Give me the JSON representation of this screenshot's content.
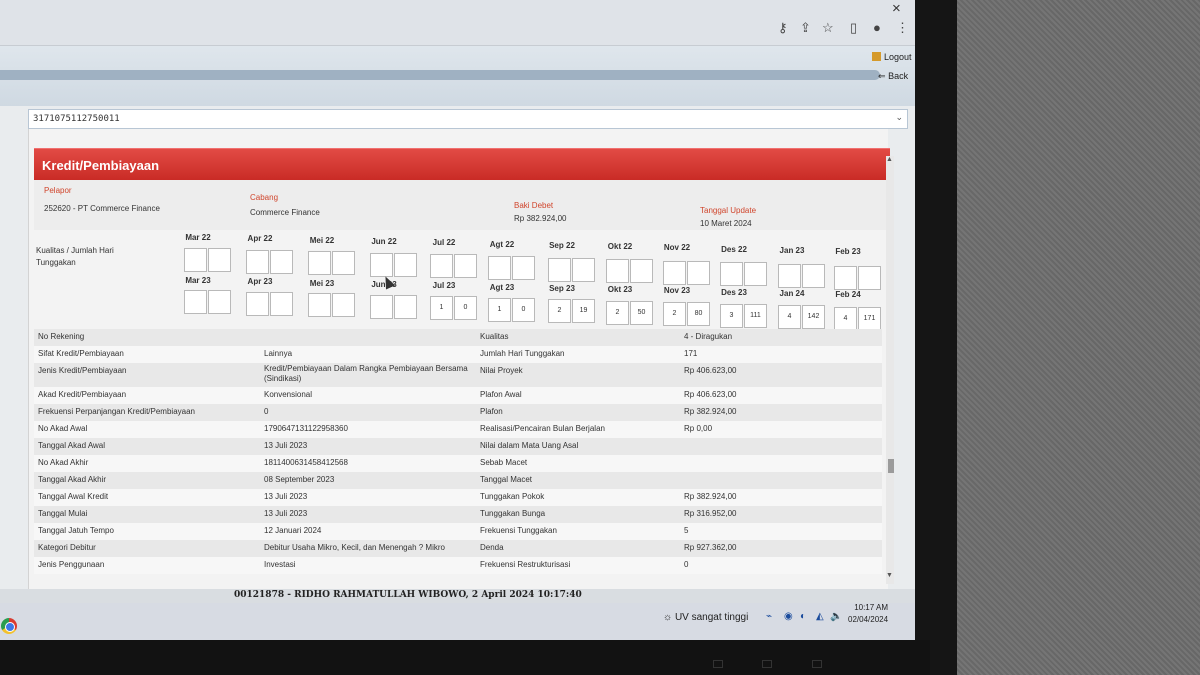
{
  "header": {
    "logout": "Logout",
    "back": "Back"
  },
  "nav": {
    "id": "317107511275001​1"
  },
  "section": {
    "title": "Kredit/Pembiayaan"
  },
  "info": {
    "pelapor_label": "Pelapor",
    "pelapor_value": "252620 - PT Commerce Finance",
    "cabang_label": "Cabang",
    "cabang_value": "Commerce Finance",
    "baki_label": "Baki Debet",
    "baki_value": "Rp 382.924,00",
    "tanggal_label": "Tanggal Update",
    "tanggal_value": "10 Maret 2024"
  },
  "kualitas_label": "Kualitas / Jumlah Hari Tunggakan",
  "months_row1": [
    "Mar 22",
    "Apr 22",
    "Mei 22",
    "Jun 22",
    "Jul 22",
    "Agt 22",
    "Sep 22",
    "Okt 22",
    "Nov 22",
    "Des 22",
    "Jan 23",
    "Feb 23"
  ],
  "months_row2": [
    "Mar 23",
    "Apr 23",
    "Mei 23",
    "Jun 23",
    "Jul 23",
    "Agt 23",
    "Sep 23",
    "Okt 23",
    "Nov 23",
    "Des 23",
    "Jan 24",
    "Feb 24"
  ],
  "cells_row2": [
    [
      "",
      ""
    ],
    [
      "",
      ""
    ],
    [
      "",
      ""
    ],
    [
      "",
      ""
    ],
    [
      "1",
      "0"
    ],
    [
      "1",
      "0"
    ],
    [
      "2",
      "19"
    ],
    [
      "2",
      "50"
    ],
    [
      "2",
      "80"
    ],
    [
      "3",
      "111"
    ],
    [
      "4",
      "142"
    ],
    [
      "4",
      "171"
    ]
  ],
  "table": [
    {
      "l1": "No Rekening",
      "v1": "",
      "l2": "Kualitas",
      "v2": "4 - Diragukan"
    },
    {
      "l1": "Sifat Kredit/Pembiayaan",
      "v1": "Lainnya",
      "l2": "Jumlah Hari Tunggakan",
      "v2": "171"
    },
    {
      "l1": "Jenis Kredit/Pembiayaan",
      "v1": "Kredit/Pembiayaan Dalam Rangka Pembiayaan Bersama (Sindikasi)",
      "l2": "Nilai Proyek",
      "v2": "Rp 406.623,00"
    },
    {
      "l1": "Akad Kredit/Pembiayaan",
      "v1": "Konvensional",
      "l2": "Plafon Awal",
      "v2": "Rp 406.623,00"
    },
    {
      "l1": "Frekuensi Perpanjangan Kredit/Pembiayaan",
      "v1": "0",
      "l2": "Plafon",
      "v2": "Rp 382.924,00"
    },
    {
      "l1": "No Akad Awal",
      "v1": "1790647131122958360",
      "l2": "Realisasi/Pencairan Bulan Berjalan",
      "v2": "Rp 0,00"
    },
    {
      "l1": "Tanggal Akad Awal",
      "v1": "13 Juli 2023",
      "l2": "Nilai dalam Mata Uang Asal",
      "v2": ""
    },
    {
      "l1": "No Akad Akhir",
      "v1": "181140063145841256​8",
      "l2": "Sebab Macet",
      "v2": ""
    },
    {
      "l1": "Tanggal Akad Akhir",
      "v1": "08 September 2023",
      "l2": "Tanggal Macet",
      "v2": ""
    },
    {
      "l1": "Tanggal Awal Kredit",
      "v1": "13 Juli 2023",
      "l2": "Tunggakan Pokok",
      "v2": "Rp 382.924,00"
    },
    {
      "l1": "Tanggal Mulai",
      "v1": "13 Juli 2023",
      "l2": "Tunggakan Bunga",
      "v2": "Rp 316.952,00"
    },
    {
      "l1": "Tanggal Jatuh Tempo",
      "v1": "12 Januari 2024",
      "l2": "Frekuensi Tunggakan",
      "v2": "5"
    },
    {
      "l1": "Kategori Debitur",
      "v1": "Debitur Usaha Mikro, Kecil, dan Menengah ? Mikro",
      "l2": "Denda",
      "v2": "Rp 927.362,00"
    },
    {
      "l1": "Jenis Penggunaan",
      "v1": "Investasi",
      "l2": "Frekuensi Restrukturisasi",
      "v2": "0"
    }
  ],
  "footer": {
    "text": "00121878 - RIDHO RAHMATULLAH WIBOWO, 2 April 2024 10:17:40"
  },
  "taskbar": {
    "uv": "UV sangat tinggi",
    "time": "10:17 AM",
    "date": "02/04/2024"
  }
}
